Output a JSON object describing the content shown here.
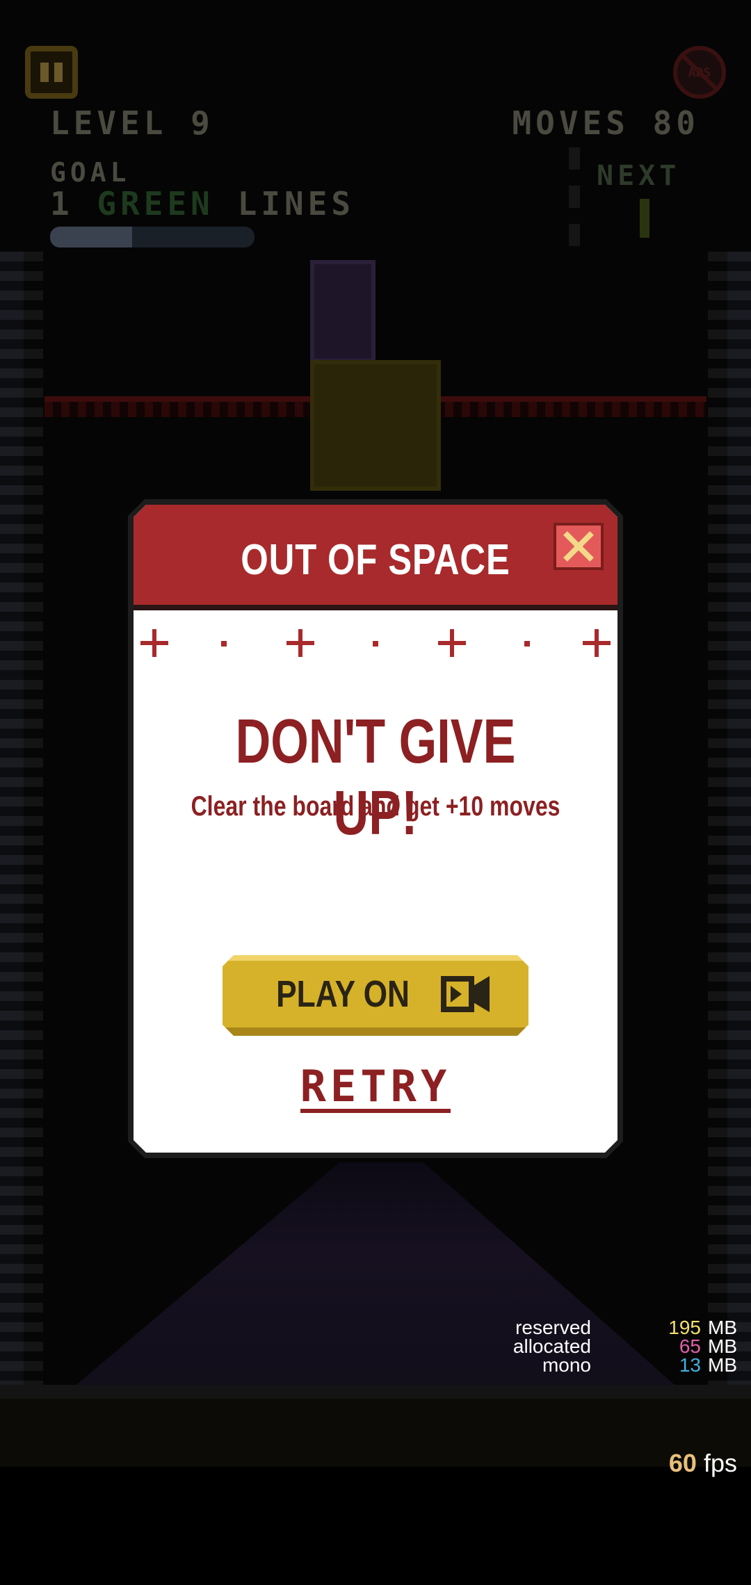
{
  "hud": {
    "level": "LEVEL 9",
    "moves": "MOVES 80",
    "goal_label": "GOAL",
    "goal_count": "1",
    "goal_color": "GREEN",
    "goal_suffix": "LINES",
    "goal_progress": 0.4,
    "next_label": "NEXT",
    "ads_label": "ADS"
  },
  "modal": {
    "title": "OUT OF SPACE",
    "heading": "DON'T GIVE UP!",
    "subtitle": "Clear the board and get +10 moves",
    "play_on_label": "PLAY ON",
    "retry_label": "RETRY"
  },
  "debug": {
    "memory": [
      {
        "label": "reserved",
        "value": "195",
        "unit": "MB",
        "color": "#f4e06a"
      },
      {
        "label": "allocated",
        "value": "65",
        "unit": "MB",
        "color": "#e060a8"
      },
      {
        "label": "mono",
        "value": "13",
        "unit": "MB",
        "color": "#40b0e0"
      }
    ],
    "fps_value": "60",
    "fps_unit": "fps"
  },
  "colors": {
    "modal_header": "#a82a2c",
    "accent_text": "#8c2022",
    "play_on_button": "#d6b22a"
  }
}
